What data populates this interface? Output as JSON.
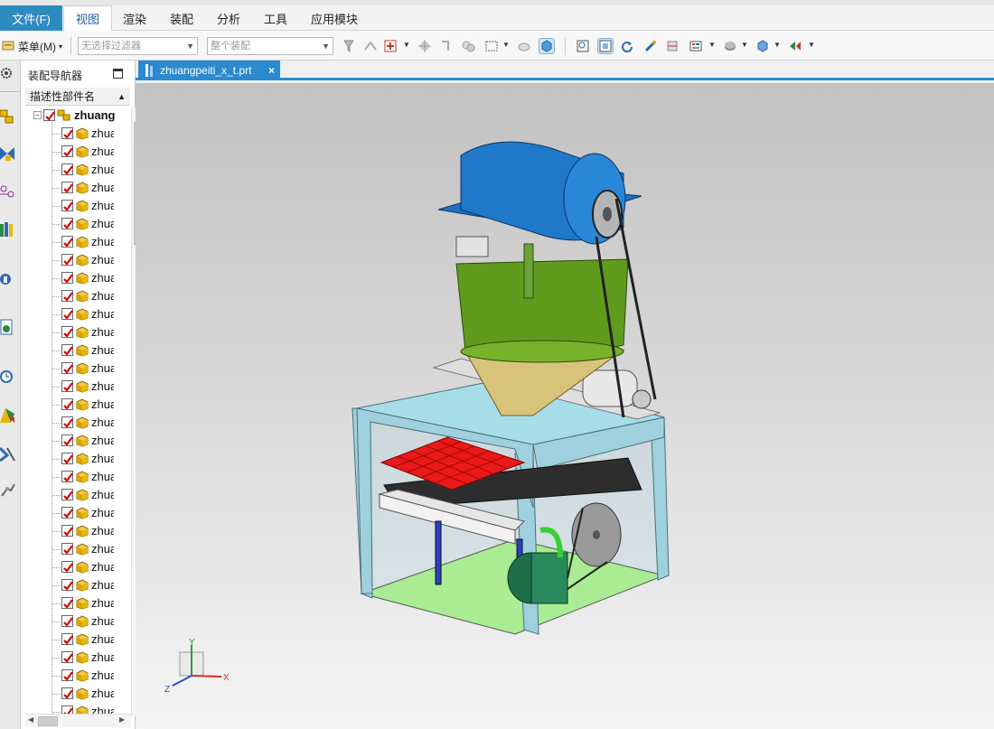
{
  "menubar": {
    "file_menu": "文件(F)",
    "tabs": [
      "视图",
      "渲染",
      "装配",
      "分析",
      "工具",
      "应用模块"
    ],
    "active_tab": "视图"
  },
  "toolbar": {
    "menu_button": "菜单(M)",
    "filter_placeholder": "无选择过滤器",
    "scope_value": "整个装配"
  },
  "navigator": {
    "title": "装配导航器",
    "column_header": "描述性部件名",
    "root_label": "zhuang",
    "child_label": "zhua"
  },
  "document": {
    "tab_name": "zhuangpeiti_x_t.prt",
    "close_glyph": "×"
  },
  "triad": {
    "x": "X",
    "y": "Y",
    "z": "Z"
  },
  "colors": {
    "accent_blue": "#2b8ad0",
    "file_button": "#2e8bc0",
    "checkbox_red": "#d90000",
    "part_icon_yellow": "#e8b800",
    "motor_blue": "#1f79c8",
    "hopper_green": "#5f9c1e",
    "frame_cyan": "#9fd0dd",
    "base_green": "#a9ec93",
    "tray_red": "#e81a1a"
  },
  "icons": {
    "resource_bar": [
      "settings-icon",
      "assembly-navigator-icon",
      "constraint-navigator-icon",
      "part-navigator-icon",
      "reuse-library-icon",
      "hd3d-tools-icon",
      "web-browser-icon",
      "history-icon",
      "system-materials-icon",
      "process-studio-icon",
      "roles-icon"
    ],
    "toolbar": [
      "selection-filter-icon",
      "snap-point-icon",
      "add-icon",
      "drag-icon",
      "move-icon",
      "group-icon",
      "box-select-icon",
      "hide-icon",
      "shaded-view-icon",
      "fit-icon",
      "zoom-icon",
      "rotate-icon",
      "pan-icon",
      "section-icon",
      "layer-icon",
      "render-style-icon",
      "orient-icon",
      "show-hide-icon"
    ]
  }
}
